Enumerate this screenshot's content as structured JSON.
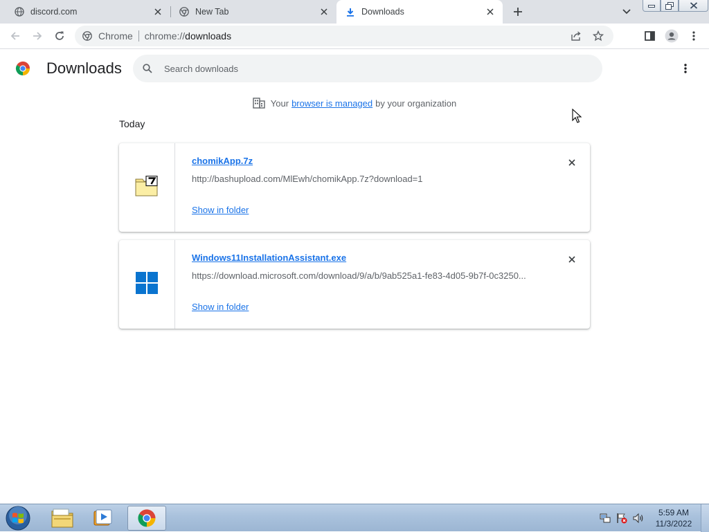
{
  "tabs": [
    {
      "title": "discord.com",
      "icon": "globe-icon"
    },
    {
      "title": "New Tab",
      "icon": "chrome-icon"
    },
    {
      "title": "Downloads",
      "icon": "download-icon",
      "active": true
    }
  ],
  "toolbar": {
    "chip_label": "Chrome",
    "url_scheme": "chrome://",
    "url_host": "downloads"
  },
  "downloads_page": {
    "title": "Downloads",
    "search_placeholder": "Search downloads",
    "managed": {
      "prefix": "Your",
      "link": "browser is managed",
      "suffix": "by your organization"
    },
    "section_date": "Today",
    "items": [
      {
        "file_name": "chomikApp.7z",
        "url": "http://bashupload.com/MlEwh/chomikApp.7z?download=1",
        "action": "Show in folder",
        "icon": "7z-archive-icon"
      },
      {
        "file_name": "Windows11InstallationAssistant.exe",
        "url": "https://download.microsoft.com/download/9/a/b/9ab525a1-fe83-4d05-9b7f-0c3250...",
        "action": "Show in folder",
        "icon": "windows-logo-icon"
      }
    ]
  },
  "taskbar": {
    "time": "5:59 AM",
    "date": "11/3/2022"
  },
  "colors": {
    "accent": "#1a73e8",
    "tabstrip": "#dee1e6",
    "omnibox": "#f1f3f4"
  }
}
